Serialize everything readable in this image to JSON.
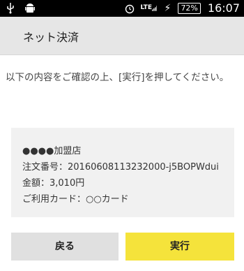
{
  "status_bar": {
    "left_icons": [
      "usb-icon",
      "android-icon"
    ],
    "network": "LTE",
    "battery": "72%",
    "time": "16:07"
  },
  "app_bar": {
    "title": "ネット決済"
  },
  "instruction": "以下の内容をご確認の上、[実行]を押してください。",
  "details": {
    "merchant": "●●●●加盟店",
    "order_number": "注文番号：20160608113232000-j5BOPWdui",
    "amount": "金額：3,010円",
    "card": "ご利用カード：○○カード"
  },
  "buttons": {
    "back": "戻る",
    "execute": "実行"
  },
  "colors": {
    "execute_button": "#f5e33b",
    "back_button": "#e0e0e0",
    "app_bar": "#e6e6e6"
  }
}
